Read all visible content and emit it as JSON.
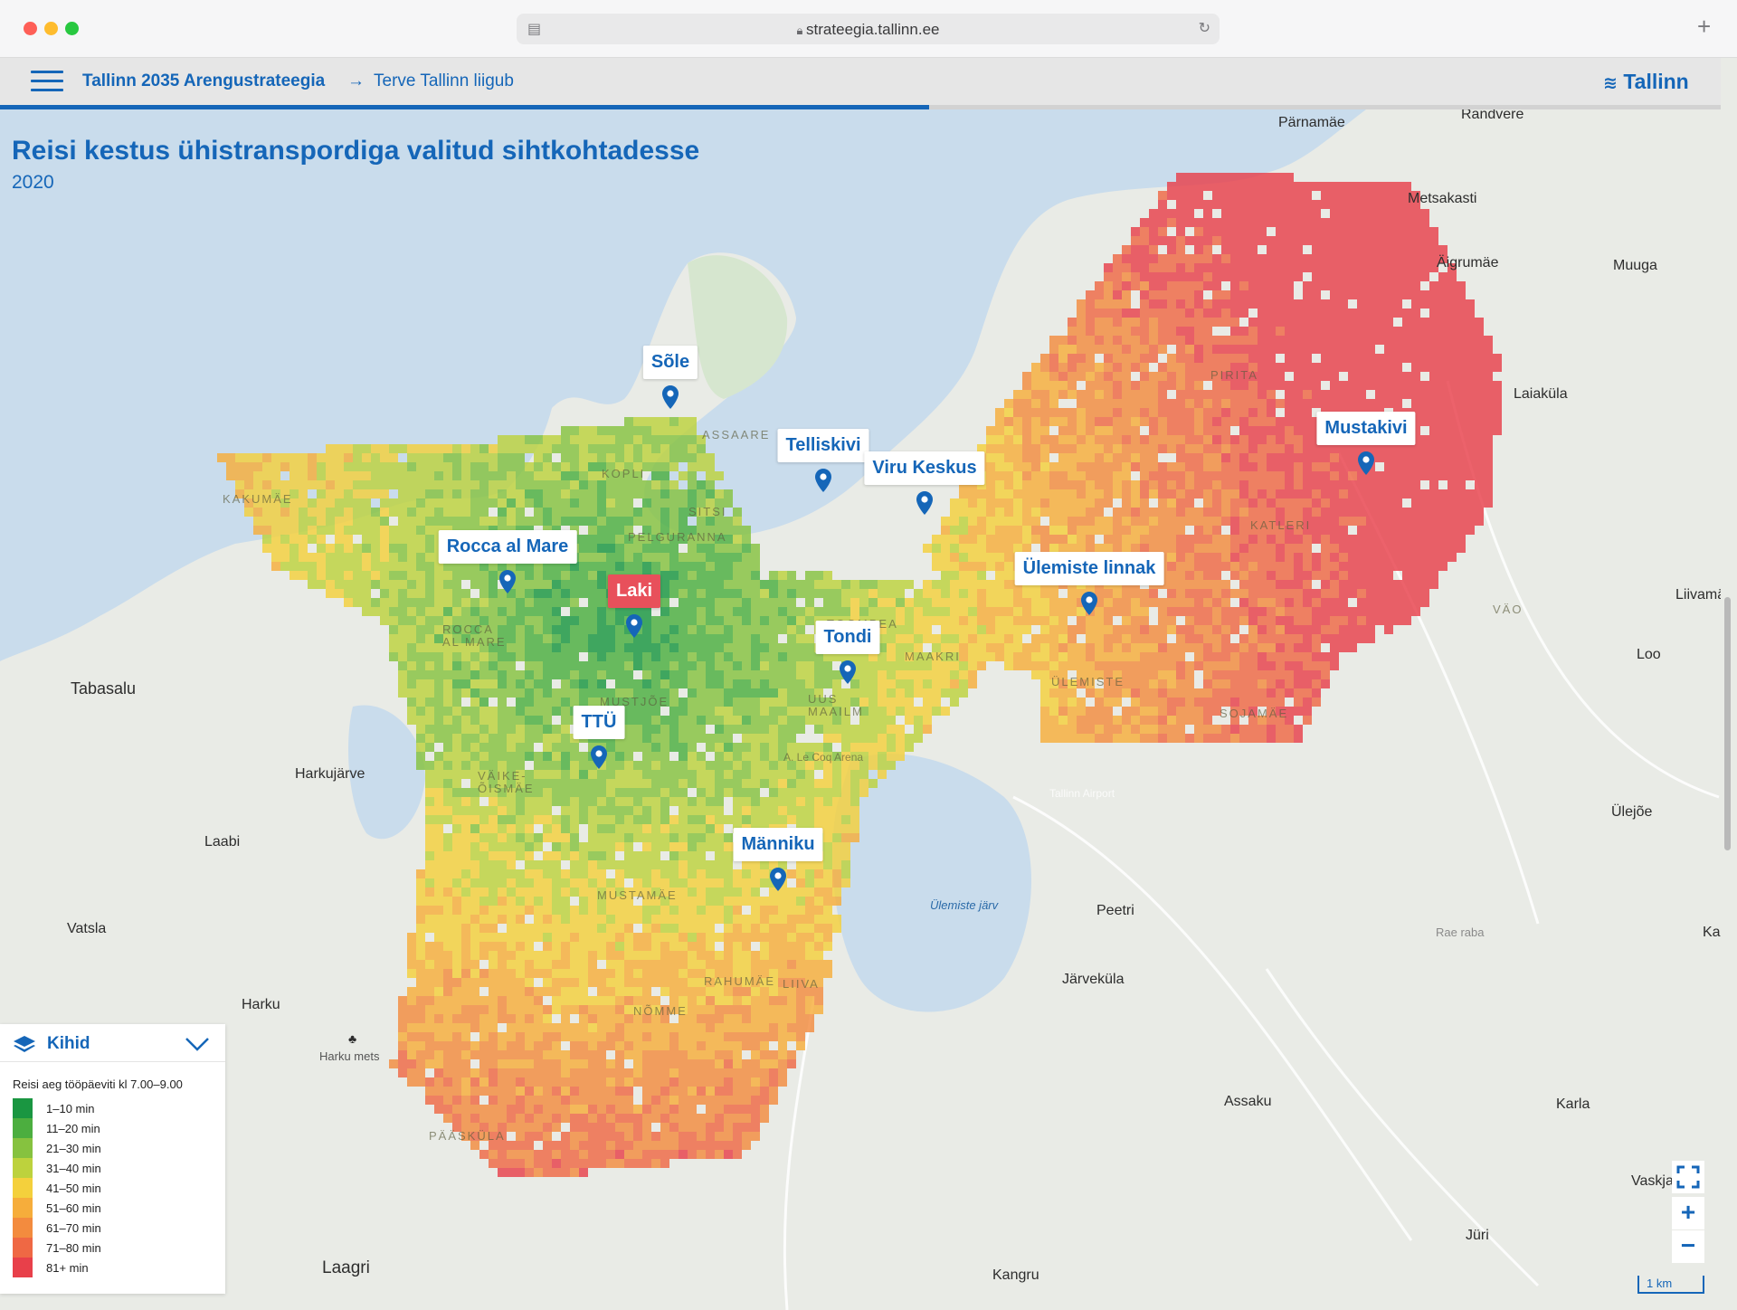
{
  "browser": {
    "url": "strateegia.tallinn.ee"
  },
  "header": {
    "breadcrumb_root": "Tallinn 2035 Arengustrateegia",
    "breadcrumb_arrow": "→",
    "breadcrumb_current": "Terve Tallinn liigub",
    "logo": "Tallinn",
    "progress_fraction": 0.54
  },
  "map": {
    "title": "Reisi kestus ühistranspordiga valitud sihtkohtadesse",
    "subtitle": "2020",
    "water_label": "Ülemiste järv",
    "places": [
      "Pärnamäe",
      "Randvere",
      "Metsakasti",
      "Äigrumäe",
      "Muuga",
      "Laiaküla",
      "Liivamä",
      "Loo",
      "Tabasalu",
      "Harkujärve",
      "Laabi",
      "Vatsla",
      "Harku",
      "Harku mets",
      "Laagri",
      "Kangru",
      "Assaku",
      "Järveküla",
      "Peetri",
      "Karla",
      "Jüri",
      "Vaskja",
      "Ülejõe",
      "Ka",
      "Rae raba"
    ],
    "districts": [
      "KAKUMÄE",
      "ROCCA\nAL MARE",
      "KOPLI",
      "SITSI",
      "PELGURANNA",
      "ASSAARE",
      "TOOMPEA",
      "MAAKRI",
      "MUSTJÕE",
      "VÄIKE-\nÕISMÄE",
      "UUS\nMAAILM",
      "MUSTAMÄE",
      "RAHUMÄE",
      "LIIVA",
      "NÕMME",
      "PÄÄSKÜLA",
      "PIRITA",
      "KATLERI",
      "VÄO",
      "SOJAMÄE",
      "ÜLEMISTE",
      "A. Le Coq Arena",
      "Tallinn Airport"
    ],
    "destinations": [
      {
        "name": "Sõle",
        "active": false
      },
      {
        "name": "Telliskivi",
        "active": false
      },
      {
        "name": "Viru Keskus",
        "active": false
      },
      {
        "name": "Mustakivi",
        "active": false
      },
      {
        "name": "Rocca al Mare",
        "active": false
      },
      {
        "name": "Laki",
        "active": true
      },
      {
        "name": "Ülemiste linnak",
        "active": false
      },
      {
        "name": "Tondi",
        "active": false
      },
      {
        "name": "TTÜ",
        "active": false
      },
      {
        "name": "Männiku",
        "active": false
      }
    ],
    "controls": {
      "fullscreen_icon": "fullscreen-icon",
      "zoom_in": "+",
      "zoom_out": "−",
      "scale": "1 km"
    }
  },
  "legend": {
    "title": "Kihid",
    "caption": "Reisi aeg tööpäeviti kl 7.00–9.00",
    "items": [
      {
        "label": "1–10 min",
        "color": "#1a9641"
      },
      {
        "label": "11–20 min",
        "color": "#4cae3f"
      },
      {
        "label": "21–30 min",
        "color": "#86c23f"
      },
      {
        "label": "31–40 min",
        "color": "#bdd23d"
      },
      {
        "label": "41–50 min",
        "color": "#f4d03c"
      },
      {
        "label": "51–60 min",
        "color": "#f6ad3b"
      },
      {
        "label": "61–70 min",
        "color": "#f38b3e"
      },
      {
        "label": "71–80 min",
        "color": "#ef6844"
      },
      {
        "label": "81+ min",
        "color": "#e8404a"
      }
    ]
  }
}
